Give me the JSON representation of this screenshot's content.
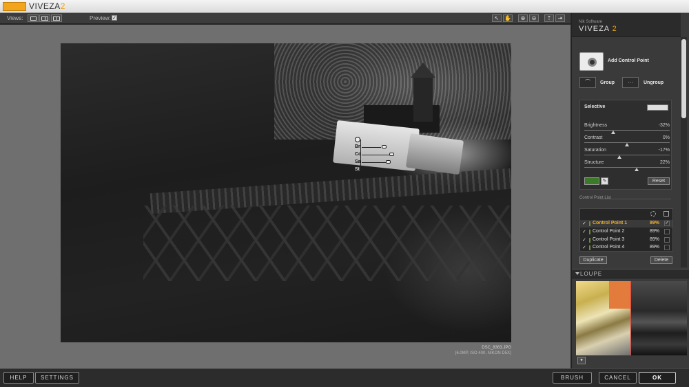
{
  "app": {
    "title": "VIVEZA",
    "version": "2"
  },
  "viewbar": {
    "views_label": "Views:",
    "preview_label": "Preview:",
    "preview_checked": "✓",
    "tools": [
      "↖",
      "✋",
      "⊕",
      "⊖",
      "⇡",
      "⇥"
    ]
  },
  "photo": {
    "filename": "DSC_8363.JPG",
    "details": "(6.0MP, ISO 400, NIKON D5X)"
  },
  "control_point": {
    "sliders": [
      "Br",
      "Co",
      "Sa",
      "St"
    ]
  },
  "panel": {
    "brand_company": "Nik Software",
    "brand_product": "VIVEZA",
    "brand_version": "2",
    "add_control_point": "Add Control Point",
    "group": "Group",
    "ungroup": "Ungroup",
    "selective": {
      "title": "Selective",
      "sliders": [
        {
          "name": "Brightness",
          "value": "-32%",
          "level": -0.32
        },
        {
          "name": "Contrast",
          "value": "0%",
          "level": 0
        },
        {
          "name": "Saturation",
          "value": "-17%",
          "level": -0.17
        },
        {
          "name": "Structure",
          "value": "22%",
          "level": 0.22
        }
      ],
      "reset": "Reset"
    },
    "control_point_list": {
      "title": "Control Point List",
      "rows": [
        {
          "check": "✓",
          "name": "Control Point 1",
          "pct": "89%",
          "box": "✓"
        },
        {
          "check": "✓",
          "name": "Control Point 2",
          "pct": "89%",
          "box": ""
        },
        {
          "check": "✓",
          "name": "Control Point 3",
          "pct": "89%",
          "box": ""
        },
        {
          "check": "✓",
          "name": "Control Point 4",
          "pct": "89%",
          "box": ""
        }
      ],
      "duplicate": "Duplicate",
      "delete": "Delete"
    },
    "loupe": {
      "title": "LOUPE"
    }
  },
  "bottom": {
    "help": "HELP",
    "settings": "SETTINGS",
    "brush": "BRUSH",
    "cancel": "CANCEL",
    "ok": "OK"
  }
}
